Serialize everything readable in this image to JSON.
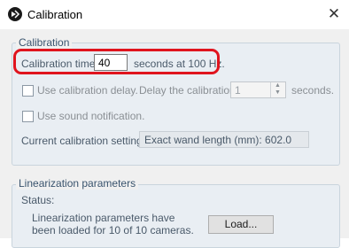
{
  "window": {
    "title": "Calibration",
    "close_glyph": "✕"
  },
  "calibration": {
    "legend": "Calibration",
    "time_label": "Calibration time",
    "time_value": "40",
    "time_suffix": "seconds at 100 Hz.",
    "use_delay_label": "Use calibration delay.",
    "use_delay_checked": false,
    "delay_label": "Delay the calibration",
    "delay_value": "1",
    "delay_unit": "seconds.",
    "sound_label": "Use sound notification.",
    "sound_checked": false,
    "current_settings_label": "Current calibration settings:",
    "current_settings_value": "Exact wand length (mm): 602.0"
  },
  "linearization": {
    "legend": "Linearization parameters",
    "status_label": "Status:",
    "status_line1": "Linearization parameters have",
    "status_line2": "been loaded for 10 of 10 cameras.",
    "load_button": "Load..."
  },
  "colors": {
    "highlight": "#e0141e",
    "group_background": "#e9eef3",
    "legend_text": "#39536d"
  },
  "icons": [
    "app-icon",
    "close-icon",
    "checkbox",
    "spin-up-icon",
    "spin-down-icon"
  ]
}
